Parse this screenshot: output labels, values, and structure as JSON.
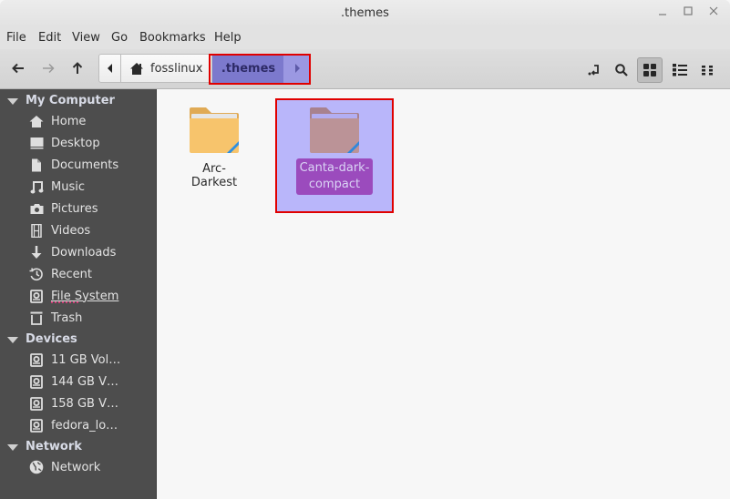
{
  "window": {
    "title": ".themes",
    "controls": {
      "minimize": "minimize",
      "maximize": "maximize",
      "close": "close"
    }
  },
  "menubar": {
    "items": [
      "File",
      "Edit",
      "View",
      "Go",
      "Bookmarks",
      "Help"
    ]
  },
  "toolbar": {
    "back": "back-arrow-icon",
    "forward": "forward-arrow-icon",
    "up": "up-arrow-icon",
    "breadcrumb": {
      "home_label": "fosslinux",
      "current_label": ".themes"
    },
    "right_buttons": [
      "toggle-location-icon",
      "search-icon",
      "icon-view-icon",
      "list-view-icon",
      "compact-view-icon"
    ],
    "active_view": "icon-view"
  },
  "sidebar": {
    "sections": [
      {
        "title": "My Computer",
        "items": [
          {
            "label": "Home",
            "icon": "home-icon"
          },
          {
            "label": "Desktop",
            "icon": "desktop-icon"
          },
          {
            "label": "Documents",
            "icon": "document-icon"
          },
          {
            "label": "Music",
            "icon": "music-icon"
          },
          {
            "label": "Pictures",
            "icon": "camera-icon"
          },
          {
            "label": "Videos",
            "icon": "film-icon"
          },
          {
            "label": "Downloads",
            "icon": "download-icon"
          },
          {
            "label": "Recent",
            "icon": "history-icon"
          },
          {
            "label": "File System",
            "icon": "drive-icon"
          },
          {
            "label": "Trash",
            "icon": "trash-icon"
          }
        ]
      },
      {
        "title": "Devices",
        "items": [
          {
            "label": "11 GB Vol…",
            "icon": "drive-icon"
          },
          {
            "label": "144 GB V…",
            "icon": "drive-icon"
          },
          {
            "label": "158 GB V…",
            "icon": "drive-icon"
          },
          {
            "label": "fedora_lo…",
            "icon": "drive-icon"
          }
        ]
      },
      {
        "title": "Network",
        "items": [
          {
            "label": "Network",
            "icon": "globe-icon"
          }
        ]
      }
    ]
  },
  "files": [
    {
      "name": "Arc-Darkest",
      "type": "folder",
      "selected": false
    },
    {
      "name": "Canta-dark-compact",
      "name_line1": "Canta-dark-",
      "name_line2": "compact",
      "type": "folder",
      "selected": true
    }
  ],
  "colors": {
    "sidebar_bg": "#4d4d4d",
    "selection_bg": "#b9b6fa",
    "selection_label_bg": "#9b4bbd",
    "breadcrumb_active": "#7c79cd",
    "highlight_box": "#e00000",
    "folder": "#f7c46c",
    "folder_stripe": "#2e8fe0"
  }
}
